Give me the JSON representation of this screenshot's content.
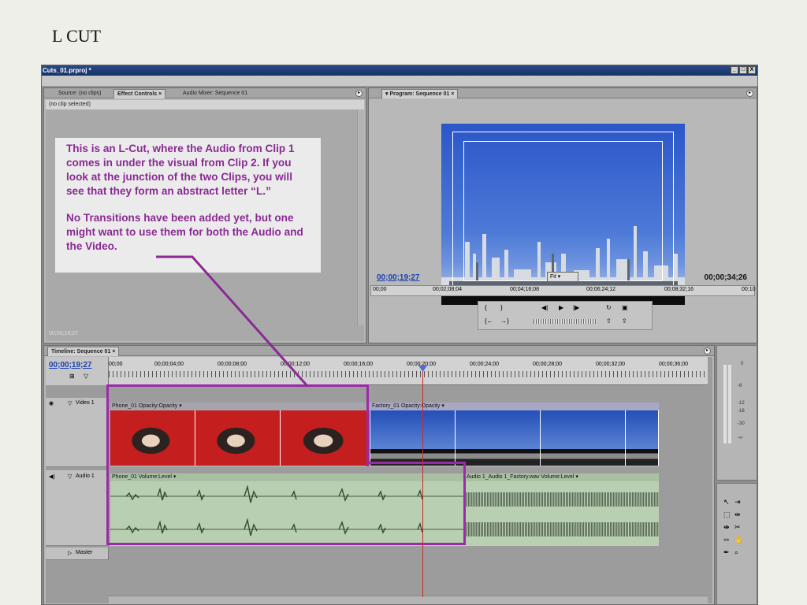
{
  "slide": {
    "title": "L CUT"
  },
  "window": {
    "title": "Cuts_01.prproj *",
    "btn_min": "_",
    "btn_max": "□",
    "btn_close": "X"
  },
  "source_panel": {
    "tabs": [
      "Source: (no clips)",
      "Effect Controls",
      "Audio Mixer: Sequence 01"
    ],
    "tab_close": "×",
    "header": "(no clip selected)",
    "footer_tc": "00;00;19;27"
  },
  "annotation": {
    "p1": "This is an L-Cut, where the Audio from Clip 1 comes in under the visual from Clip 2. If you look at the junction of the two Clips, you will see that they form an abstract letter “L.”",
    "p2": "No Transitions have been added yet, but one might want to use them for both the Audio and the Video."
  },
  "program_panel": {
    "tab": "▾ Program: Sequence 01",
    "tab_close": "×",
    "timecode_current": "00;00;19;27",
    "timecode_duration": "00;00;34;26",
    "zoom": "Fit",
    "ruler": [
      "00;00",
      "00;02;08;04",
      "00;04;16;08",
      "00;06;24;12",
      "00;08;32;16",
      "00;10"
    ]
  },
  "timeline": {
    "tab": "Timeline: Sequence 01",
    "tab_close": "×",
    "timecode": "00;00;19;27",
    "ruler": [
      "00;00",
      "00;00;04;00",
      "00;00;08;00",
      "00;00;12;00",
      "00;00;16;00",
      "00;00;20;00",
      "00;00;24;00",
      "00;00;28;00",
      "00;00;32;00",
      "00;00;36;00"
    ],
    "tracks": {
      "video": "Video 1",
      "audio": "Audio 1",
      "master": "Master"
    },
    "clips": {
      "v1": "Phone_01  Opacity:Opacity ▾",
      "v2": "Factory_01  Opacity:Opacity ▾",
      "a1": "Phone_01  Volume:Level ▾",
      "a2": "Audio 1_Audio 1_Factory.wav  Volume:Level ▾"
    }
  },
  "meters": [
    "0",
    "-6",
    "-12",
    "-18",
    "-30",
    "-∞"
  ]
}
